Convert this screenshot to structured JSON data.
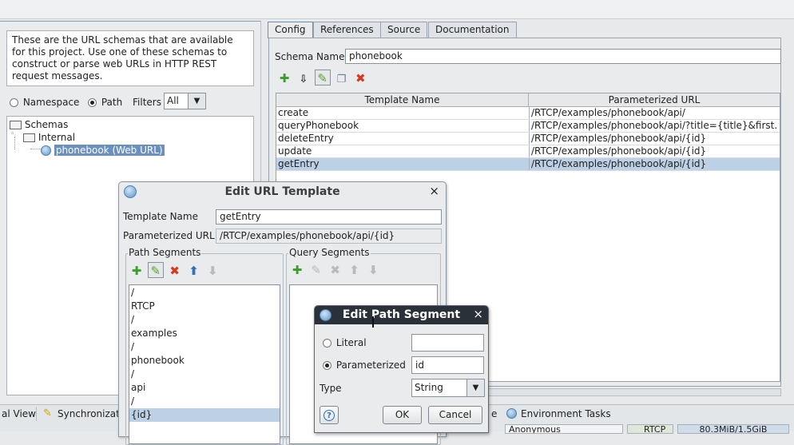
{
  "description_text": "These are the URL schemas that are available for this project. Use one of these schemas to construct or parse web URLs in HTTP REST request messages.",
  "mode": {
    "namespace_label": "Namespace",
    "path_label": "Path",
    "selected": "Path",
    "filters_label": "Filters",
    "filters_value": "All"
  },
  "tree": {
    "root": "Schemas",
    "internal": "Internal",
    "selected_item": "phonebook (Web URL)"
  },
  "tabs": [
    "Config",
    "References",
    "Source",
    "Documentation"
  ],
  "schema": {
    "name_label": "Schema Name",
    "name_value": "phonebook"
  },
  "table": {
    "columns": [
      "Template Name",
      "Parameterized URL"
    ],
    "rows": [
      {
        "name": "create",
        "url": "/RTCP/examples/phonebook/api/"
      },
      {
        "name": "queryPhonebook",
        "url": "/RTCP/examples/phonebook/api/?title={title}&first..."
      },
      {
        "name": "deleteEntry",
        "url": "/RTCP/examples/phonebook/api/{id}"
      },
      {
        "name": "update",
        "url": "/RTCP/examples/phonebook/api/{id}"
      },
      {
        "name": "getEntry",
        "url": "/RTCP/examples/phonebook/api/{id}"
      }
    ],
    "selected_row": "getEntry"
  },
  "status": {
    "item1": "al View",
    "item2": "Synchronizatio",
    "item3": "e",
    "item4": "Environment Tasks",
    "item5": "Anonymous",
    "item6": "RTCP",
    "item7": "80.3MiB/1.5GiB"
  },
  "edit_template": {
    "title": "Edit URL Template",
    "name_label": "Template Name",
    "name_value": "getEntry",
    "url_label": "Parameterized URL",
    "url_value": "/RTCP/examples/phonebook/api/{id}",
    "path_segments_label": "Path Segments",
    "query_segments_label": "Query Segments",
    "path_segments": [
      "/",
      "RTCP",
      "/",
      "examples",
      "/",
      "phonebook",
      "/",
      "api",
      "/",
      "{id}"
    ],
    "selected_segment": "{id}"
  },
  "edit_segment": {
    "title": "Edit Path Segment",
    "literal_label": "Literal",
    "literal_value": "",
    "parameterized_label": "Parameterized",
    "parameterized_value": "id",
    "selected": "Parameterized",
    "type_label": "Type",
    "type_value": "String",
    "ok_label": "OK",
    "cancel_label": "Cancel",
    "help_label": "?"
  },
  "colors": {
    "selection": "#bcd0e6",
    "add_icon": "#3aa02c",
    "delete_icon": "#d93820",
    "dialog_title_bar": "#2b3138"
  },
  "icons": [
    "add-icon",
    "export-icon",
    "edit-icon",
    "copy-icon",
    "delete-icon",
    "arrow-up-icon",
    "arrow-down-icon",
    "help-icon",
    "web-url-icon",
    "folder-icon",
    "globe-icon"
  ]
}
